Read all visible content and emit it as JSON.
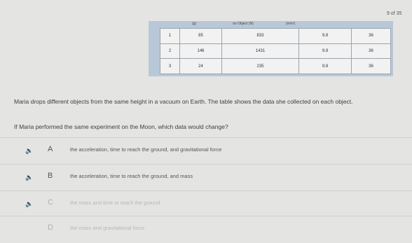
{
  "question_counter": "9 of 35",
  "table": {
    "headers": [
      "",
      "(g)",
      "on Object (N)",
      "(m/s²)",
      ""
    ],
    "rows": [
      [
        "1",
        "85",
        "833",
        "9.8",
        "36"
      ],
      [
        "2",
        "146",
        "1431",
        "9.8",
        "36"
      ],
      [
        "3",
        "24",
        "235",
        "9.8",
        "36"
      ]
    ]
  },
  "stem": "Maria drops different objects from the same height in a vacuum on Earth. The table shows the data she collected on each object.",
  "question": "If Maria performed the same experiment on the Moon, which data would change?",
  "choices": [
    {
      "letter": "A",
      "text": "the acceleration, time to reach the ground, and gravitational force"
    },
    {
      "letter": "B",
      "text": "the acceleration, time to reach the ground, and mass"
    },
    {
      "letter": "C",
      "text": "the mass and time to reach the ground"
    },
    {
      "letter": "D",
      "text": "the mass and gravitational force"
    }
  ],
  "speaker_icon": "speaker-icon"
}
